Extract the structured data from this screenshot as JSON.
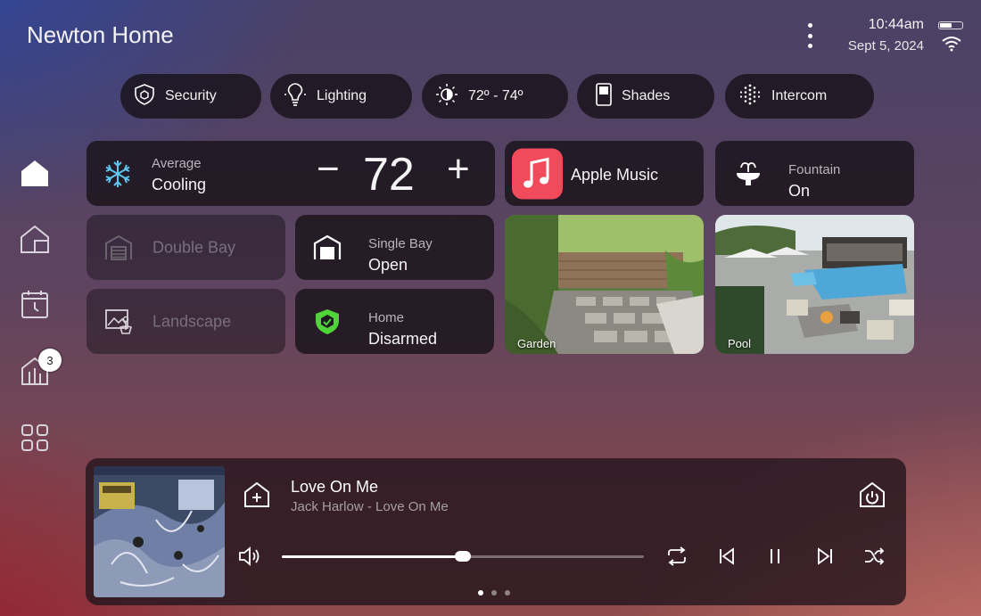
{
  "header": {
    "title": "Newton Home",
    "time": "10:44am",
    "date": "Sept 5, 2024",
    "battery_level": 0.55
  },
  "quick_chips": [
    {
      "label": "Security",
      "icon": "shield-icon"
    },
    {
      "label": "Lighting",
      "icon": "lightbulb-icon"
    },
    {
      "label": "72º - 74º",
      "icon": "climate-icon"
    },
    {
      "label": "Shades",
      "icon": "shades-icon"
    },
    {
      "label": "Intercom",
      "icon": "intercom-icon"
    }
  ],
  "sidebar": {
    "items": [
      {
        "name": "home",
        "icon": "home-filled-icon",
        "active": true
      },
      {
        "name": "rooms",
        "icon": "rooms-icon"
      },
      {
        "name": "calendar",
        "icon": "calendar-icon"
      },
      {
        "name": "buildings",
        "icon": "buildings-icon",
        "badge": "3"
      },
      {
        "name": "apps",
        "icon": "grid-icon"
      }
    ]
  },
  "climate": {
    "label": "Average",
    "mode": "Cooling",
    "temperature": "72",
    "minus": "−",
    "plus": "+",
    "accent": "#5ec6f0"
  },
  "music_tile": {
    "label": "Apple Music",
    "accent": "#f04a5b"
  },
  "fountain": {
    "label": "Fountain",
    "status": "On"
  },
  "double_bay": {
    "label": "Double Bay"
  },
  "single_bay": {
    "label": "Single Bay",
    "status": "Open"
  },
  "landscape": {
    "label": "Landscape"
  },
  "security_tile": {
    "label": "Home",
    "status": "Disarmed",
    "accent": "#4fd43a"
  },
  "cameras": [
    {
      "label": "Garden"
    },
    {
      "label": "Pool"
    }
  ],
  "player": {
    "song": "Love On Me",
    "artist": "Jack Harlow - Love On Me",
    "progress": 0.5,
    "page": 1,
    "pages": 3
  }
}
